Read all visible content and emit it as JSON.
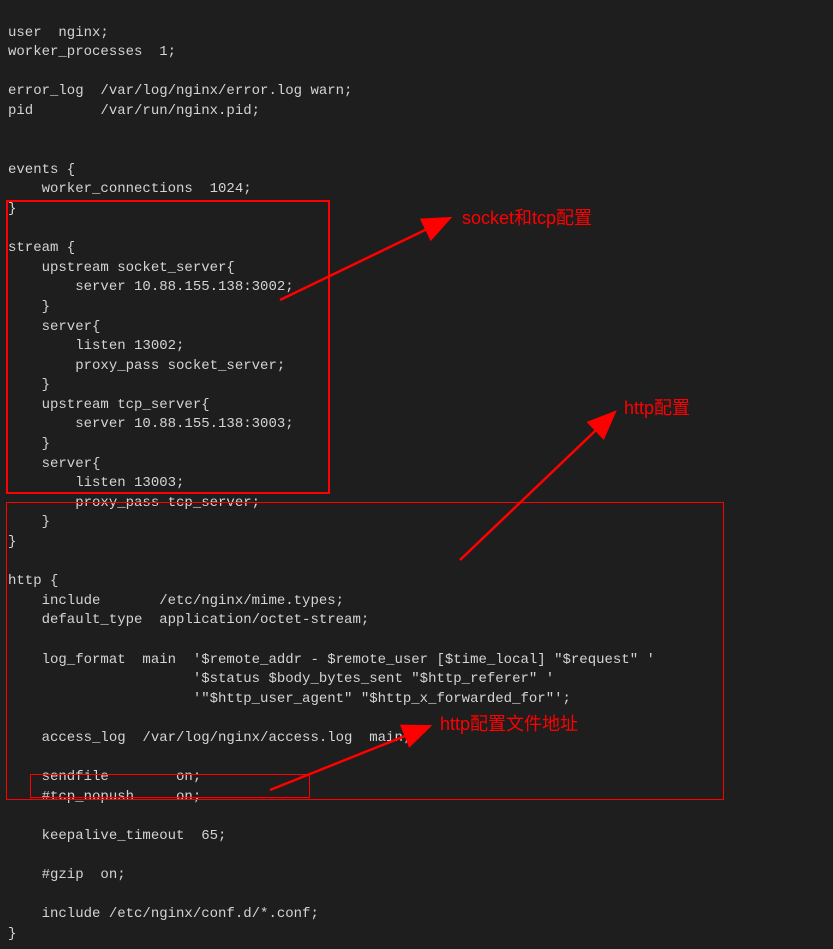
{
  "code": {
    "l1": "user  nginx;",
    "l2": "worker_processes  1;",
    "l3": "",
    "l4": "error_log  /var/log/nginx/error.log warn;",
    "l5": "pid        /var/run/nginx.pid;",
    "l6": "",
    "l7": "",
    "l8": "events {",
    "l9": "    worker_connections  1024;",
    "l10": "}",
    "l11": "",
    "l12": "stream {",
    "l13": "    upstream socket_server{",
    "l14": "        server 10.88.155.138:3002;",
    "l15": "    }",
    "l16": "    server{",
    "l17": "        listen 13002;",
    "l18": "        proxy_pass socket_server;",
    "l19": "    }",
    "l20": "    upstream tcp_server{",
    "l21": "        server 10.88.155.138:3003;",
    "l22": "    }",
    "l23": "    server{",
    "l24": "        listen 13003;",
    "l25": "        proxy_pass tcp_server;",
    "l26": "    }",
    "l27": "}",
    "l28": "",
    "l29": "http {",
    "l30": "    include       /etc/nginx/mime.types;",
    "l31": "    default_type  application/octet-stream;",
    "l32": "",
    "l33": "    log_format  main  '$remote_addr - $remote_user [$time_local] \"$request\" '",
    "l34": "                      '$status $body_bytes_sent \"$http_referer\" '",
    "l35": "                      '\"$http_user_agent\" \"$http_x_forwarded_for\"';",
    "l36": "",
    "l37": "    access_log  /var/log/nginx/access.log  main;",
    "l38": "",
    "l39": "    sendfile        on;",
    "l40": "    #tcp_nopush     on;",
    "l41": "",
    "l42": "    keepalive_timeout  65;",
    "l43": "",
    "l44": "    #gzip  on;",
    "l45": "",
    "l46": "    include /etc/nginx/conf.d/*.conf;",
    "l47": "}"
  },
  "annotations": {
    "stream_label": "socket和tcp配置",
    "http_label": "http配置",
    "include_label": "http配置文件地址"
  }
}
